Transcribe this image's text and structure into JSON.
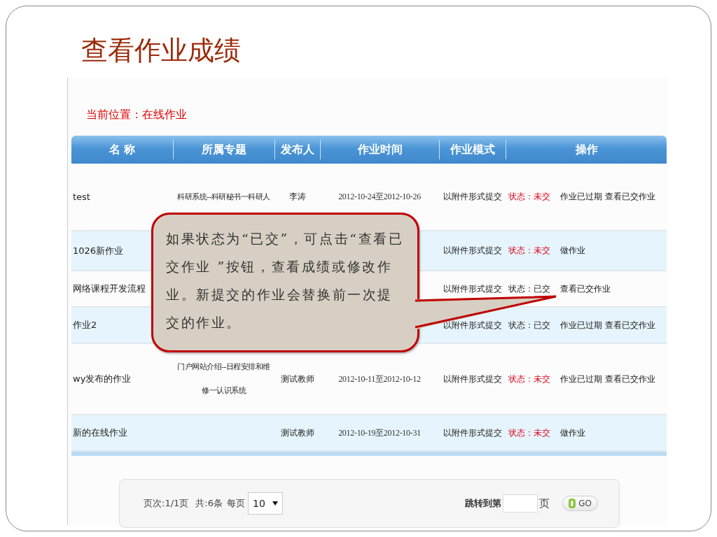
{
  "slide": {
    "title": "查看作业成绩"
  },
  "page": {
    "breadcrumb": "当前位置：在线作业",
    "table": {
      "columns": [
        "名 称",
        "所属专题",
        "发布人",
        "作业时间",
        "作业模式",
        "操作"
      ],
      "rows": [
        {
          "name": "test",
          "topic": "科研系统--科研秘书一科研人",
          "publisher": "李涛",
          "time": "2012-10-24至2012-10-26",
          "mode": "以附件形式提交",
          "status": "状态：未交",
          "submitted": false,
          "actions": [
            "作业已过期",
            "查看已交作业"
          ]
        },
        {
          "name": "1026新作业",
          "mode": "以附件形式提交",
          "status": "状态：未交",
          "submitted": false,
          "actions": [
            "做作业"
          ]
        },
        {
          "name": "网络课程开发流程",
          "mode": "以附件形式提交",
          "status": "状态：已交",
          "submitted": true,
          "actions": [
            "查看已交作业"
          ]
        },
        {
          "name": "作业2",
          "mode": "以附件形式提交",
          "status": "状态：已交",
          "submitted": true,
          "actions": [
            "作业已过期",
            "查看已交作业"
          ]
        },
        {
          "name": "wy发布的作业",
          "topic": "门户网站介绍--日程安排和维修一认识系统",
          "publisher": "测试教师",
          "time": "2012-10-11至2012-10-12",
          "mode": "以附件形式提交",
          "status": "状态：未交",
          "submitted": false,
          "actions": [
            "作业已过期",
            "查看已交作业"
          ]
        },
        {
          "name": "新的在线作业",
          "publisher": "测试教师",
          "time": "2012-10-19至2012-10-31",
          "mode": "以附件形式提交",
          "status": "状态：未交",
          "submitted": false,
          "actions": [
            "做作业"
          ]
        }
      ]
    },
    "pagination": {
      "page_info": "页次:1/1页",
      "total": "共:6条",
      "per_page_label": "每页",
      "per_page": "10",
      "jump_label": "跳转到第",
      "page_suffix": "页",
      "go": "GO"
    }
  },
  "callout": {
    "text": "如果状态为“已交”，可点击“查看已交作业 ”按钮，查看成绩或修改作业。新提交的作业会替换前一次提交的作业。"
  }
}
